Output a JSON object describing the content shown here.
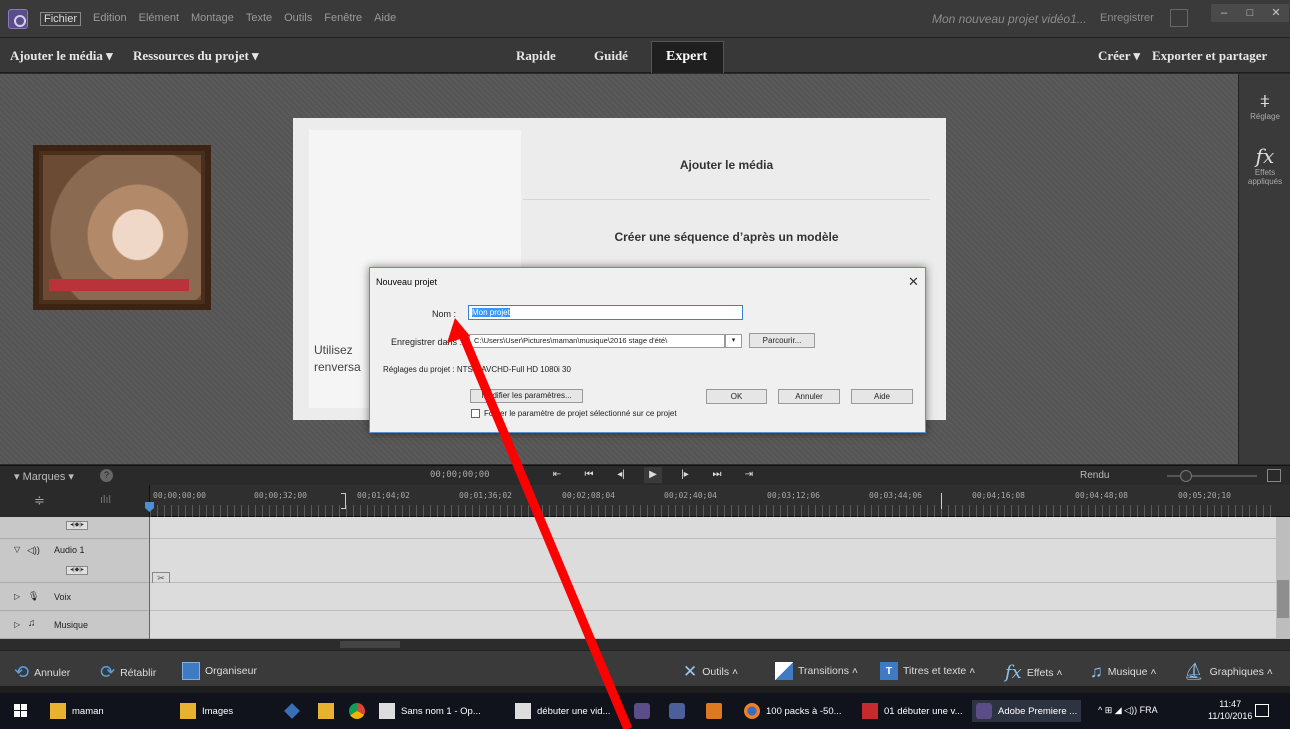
{
  "app": {
    "menu": [
      "Fichier",
      "Edition",
      "Elément",
      "Montage",
      "Texte",
      "Outils",
      "Fenêtre",
      "Aide"
    ],
    "project_title": "Mon nouveau projet vidéo1...",
    "save_label": "Enregistrer"
  },
  "toolbar": {
    "add_media": "Ajouter le média ▾",
    "project_resources": "Ressources du projet ▾",
    "mode_quick": "Rapide",
    "mode_guided": "Guidé",
    "mode_expert": "Expert",
    "create": "Créer ▾",
    "export_share": "Exporter et partager"
  },
  "right_panel": {
    "adjust_label": "Réglage",
    "effects_label": "Effets appliqués"
  },
  "welcome": {
    "option_add_media": "Ajouter le média",
    "option_template": "Créer une séquence d’après un modèle",
    "use_text_line1": "Utilisez",
    "use_text_line2": "renversa"
  },
  "dialog": {
    "title": "Nouveau projet",
    "close": "✕",
    "name_label": "Nom :",
    "name_value": "Mon projet",
    "save_in_label": "Enregistrer dans :",
    "save_path": "C:\\Users\\User\\Pictures\\maman\\musique\\2016 stage d'été\\",
    "browse_button": "Parcourir...",
    "settings_label": "Réglages du projet : NTSC-AVCHD-Full HD 1080i 30",
    "modify_button": "Modifier les paramètres...",
    "ok_button": "OK",
    "cancel_button": "Annuler",
    "help_button": "Aide",
    "force_checkbox_label": "Forcer le paramètre de projet sélectionné sur ce projet"
  },
  "timeline": {
    "marks_label": "▾ Marques ▾",
    "help": "?",
    "current_timecode": "00;00;00;00",
    "render_label": "Rendu",
    "ruler_timecodes": [
      "00;00;00;00",
      "00;00;32;00",
      "00;01;04;02",
      "00;01;36;02",
      "00;02;08;04",
      "00;02;40;04",
      "00;03;12;06",
      "00;03;44;06",
      "00;04;16;08",
      "00;04;48;08",
      "00;05;20;10"
    ],
    "tracks": [
      {
        "name": "",
        "vol": "◂|◆|▸"
      },
      {
        "name": "Audio 1",
        "vol": "◂|◆|▸"
      },
      {
        "name": "Voix",
        "vol": ""
      },
      {
        "name": "Musique",
        "vol": ""
      }
    ]
  },
  "actionbar": {
    "undo": "Annuler",
    "redo": "Rétablir",
    "organizer": "Organiseur",
    "tools": "Outils ˄",
    "transitions": "Transitions ˄",
    "titles": "Titres et texte ˄",
    "effects": "Effets ˄",
    "music": "Musique ˄",
    "graphics": "Graphiques ˄"
  },
  "taskbar": {
    "items": [
      "maman",
      "Images",
      "Sans nom 1 - Op...",
      "débuter une vid...",
      "100 packs à -50...",
      "01 débuter une v...",
      "Adobe Premiere ..."
    ],
    "tray": "^ ⊞ ◢ ◁)) FRA",
    "time": "11:47",
    "date": "11/10/2016"
  },
  "colors": {
    "accent": "#3399ff",
    "annotation_arrow": "#ff0000",
    "playhead": "#e03030"
  }
}
